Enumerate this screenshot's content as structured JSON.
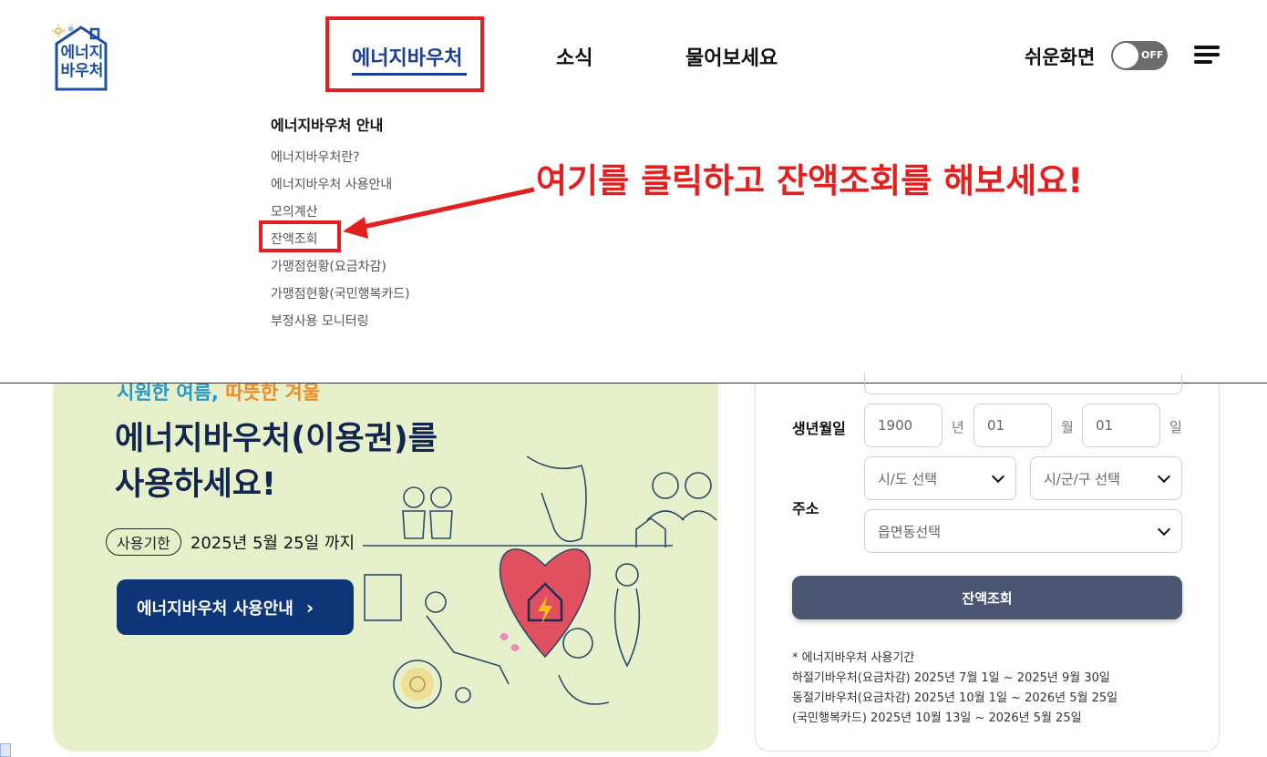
{
  "header": {
    "logo_text": "에너지\n바우처",
    "nav": [
      "에너지바우처",
      "소식",
      "물어보세요"
    ],
    "easy_mode_label": "쉬운화면",
    "toggle_state": "OFF"
  },
  "dropdown": {
    "title": "에너지바우처 안내",
    "items": [
      "에너지바우처란?",
      "에너지바우처 사용안내",
      "모의계산",
      "잔액조회",
      "가맹점현황(요금차감)",
      "가맹점현황(국민행복카드)",
      "부정사용 모니터링"
    ]
  },
  "annotation": {
    "text": "여기를 클릭하고 잔액조회를 해보세요!",
    "color": "#e41f1f"
  },
  "banner": {
    "tagline_part1": "시원한 여름, ",
    "tagline_part2": "따뜻한 겨울",
    "headline_line1": "에너지바우처(이용권)를",
    "headline_line2": "사용하세요!",
    "period_label": "사용기한",
    "period_date": "2025년 5월 25일 까지",
    "button_label": "에너지바우처 사용안내"
  },
  "form": {
    "birth_label": "생년월일",
    "year_value": "1900",
    "year_unit": "년",
    "month_value": "01",
    "month_unit": "월",
    "day_value": "01",
    "day_unit": "일",
    "address_label": "주소",
    "sido_placeholder": "시/도 선택",
    "sigungu_placeholder": "시/군/구 선택",
    "eupmyeondong_placeholder": "읍면동선택",
    "submit_label": "잔액조회",
    "notes": [
      "* 에너지바우처 사용기간",
      "하절기바우처(요금차감) 2025년 7월 1일 ~ 2025년 9월 30일",
      "동절기바우처(요금차감) 2025년 10월 1일 ~ 2026년 5월 25일",
      "(국민행복카드) 2025년 10월 13일 ~ 2026년 5월 25일"
    ]
  },
  "colors": {
    "brand_blue": "#1a3f95",
    "button_navy": "#0f3579",
    "submit_gray": "#4b5673",
    "banner_bg": "#e6f1cb",
    "highlight_red": "#e41f1f"
  }
}
